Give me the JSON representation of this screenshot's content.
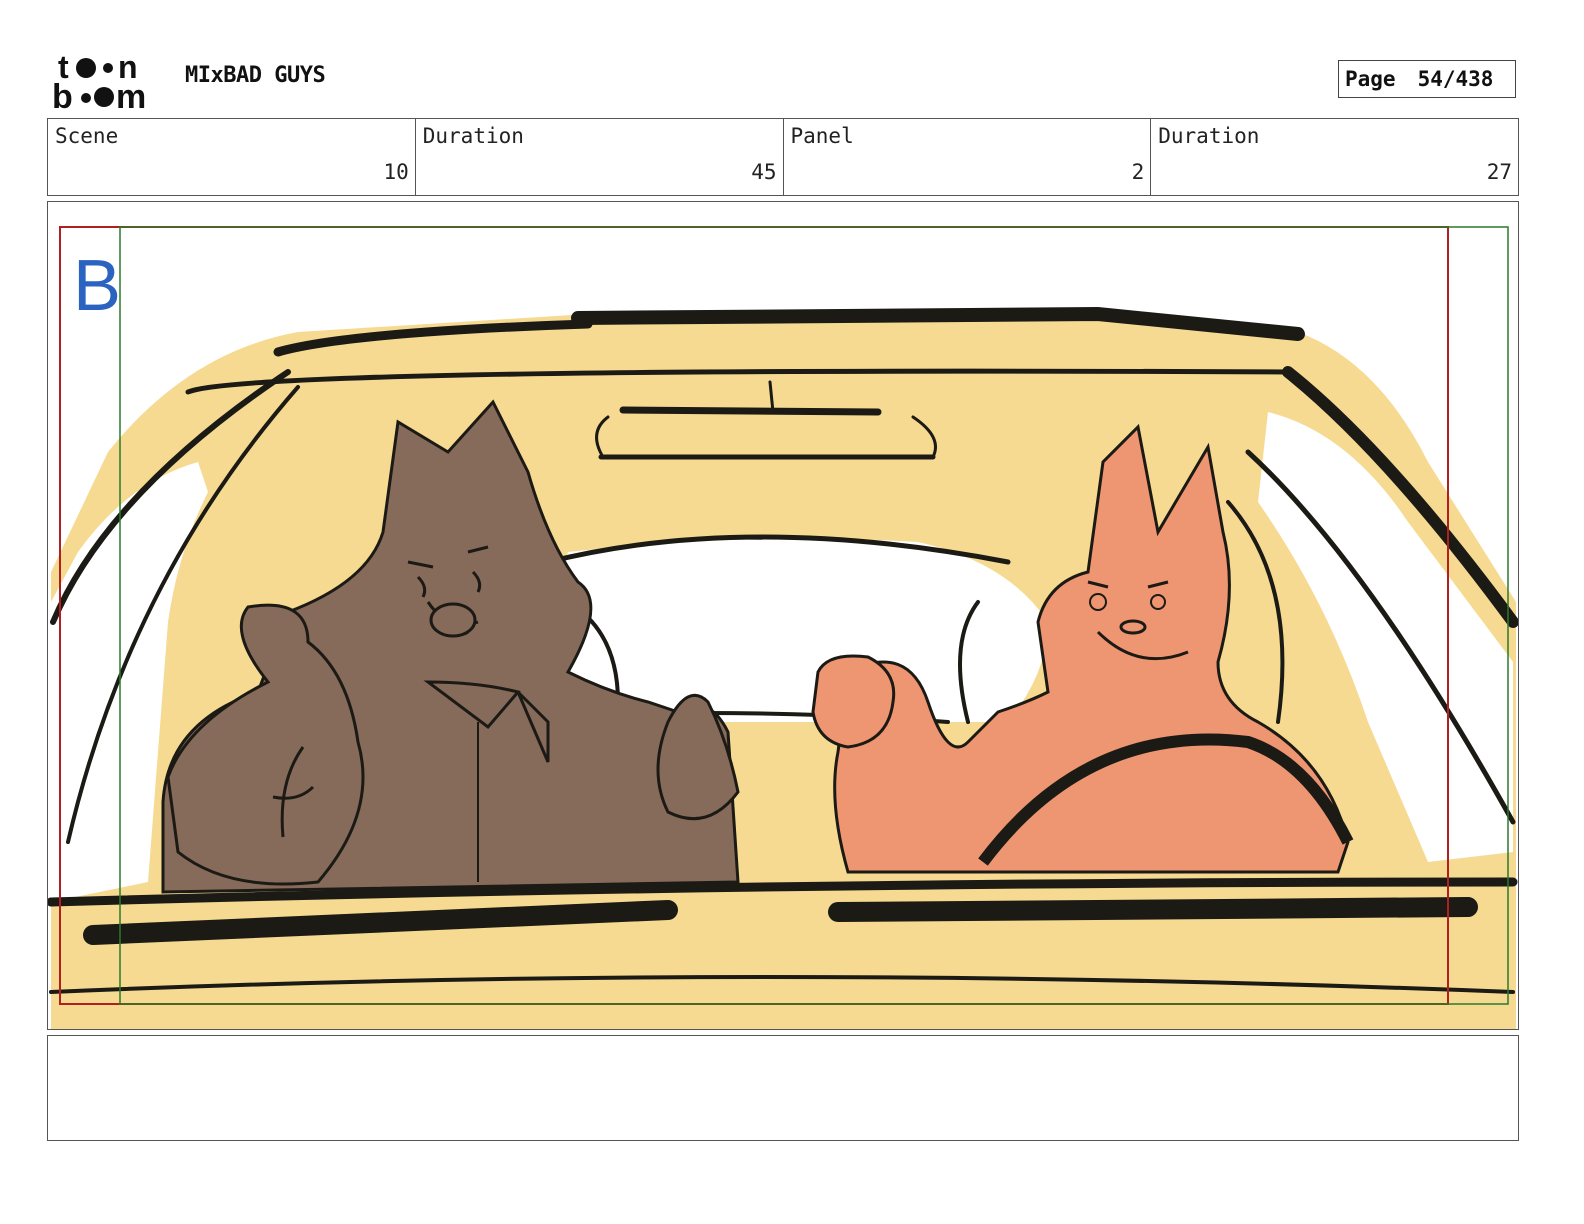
{
  "header": {
    "logo_text": "toon boom",
    "project_title": "MIxBAD GUYS",
    "page_label": "Page",
    "page_number": "54/438"
  },
  "info": [
    {
      "label": "Scene",
      "value": "10"
    },
    {
      "label": "Duration",
      "value": "45"
    },
    {
      "label": "Panel",
      "value": "2"
    },
    {
      "label": "Duration",
      "value": "27"
    }
  ],
  "panel": {
    "marker_letter": "B"
  },
  "notes": {
    "text": ""
  },
  "colors": {
    "car_yellow": "#f6da92",
    "wolf_brown": "#866a5a",
    "cat_orange": "#ee9572",
    "safe_frame_red": "#b02020",
    "action_frame_green": "#2a7a2a",
    "marker_blue": "#2a63c0"
  }
}
